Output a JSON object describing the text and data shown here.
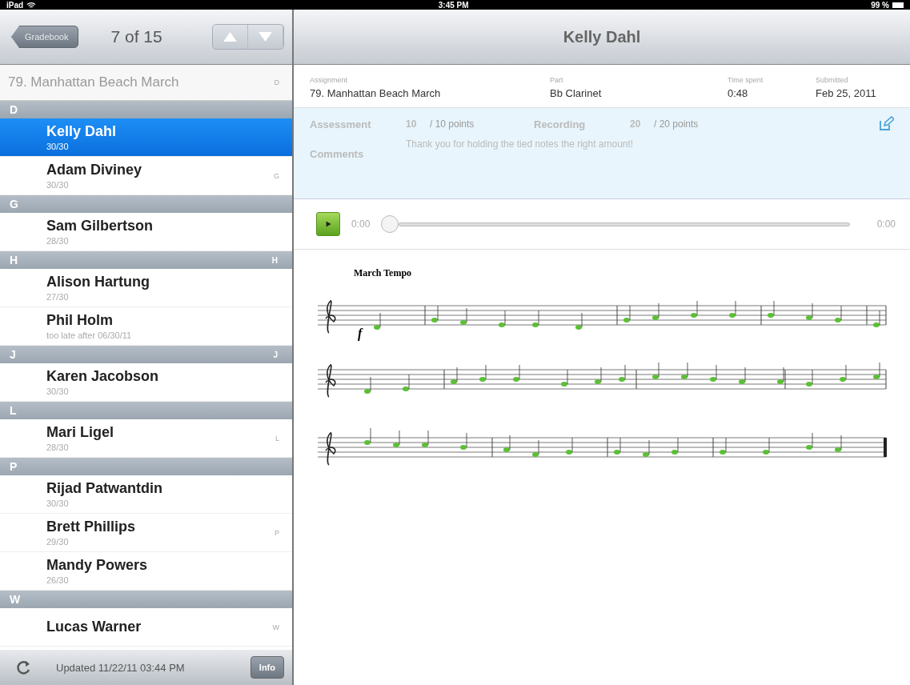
{
  "status_bar": {
    "device": "iPad",
    "time": "3:45 PM",
    "battery": "99 %"
  },
  "nav": {
    "back": "Gradebook",
    "counter": "7 of 15"
  },
  "assignment_title": {
    "text": "79. Manhattan Beach March",
    "index": "D"
  },
  "sections": [
    {
      "letter": "D",
      "students": [
        {
          "name": "Kelly Dahl",
          "score": "30/30",
          "selected": true
        },
        {
          "name": "Adam Diviney",
          "score": "30/30",
          "selected": false,
          "index": "G"
        }
      ]
    },
    {
      "letter": "G",
      "students": [
        {
          "name": "Sam Gilbertson",
          "score": "28/30",
          "selected": false
        }
      ]
    },
    {
      "letter": "H",
      "index": "H",
      "students": [
        {
          "name": "Alison Hartung",
          "score": "27/30",
          "selected": false
        },
        {
          "name": "Phil Holm",
          "score": "too late after 06/30/11",
          "selected": false
        }
      ]
    },
    {
      "letter": "J",
      "index": "J",
      "students": [
        {
          "name": "Karen Jacobson",
          "score": "30/30",
          "selected": false
        }
      ]
    },
    {
      "letter": "L",
      "students": [
        {
          "name": "Mari Ligel",
          "score": "28/30",
          "selected": false,
          "index": "L"
        }
      ]
    },
    {
      "letter": "P",
      "students": [
        {
          "name": "Rijad Patwantdin",
          "score": "30/30",
          "selected": false
        },
        {
          "name": "Brett Phillips",
          "score": "29/30",
          "selected": false,
          "index": "P"
        },
        {
          "name": "Mandy Powers",
          "score": "26/30",
          "selected": false
        }
      ]
    },
    {
      "letter": "W",
      "students": [
        {
          "name": "Lucas Warner",
          "selected": false,
          "index": "W"
        }
      ]
    }
  ],
  "footer": {
    "updated": "Updated 11/22/11 03:44 PM",
    "info": "Info"
  },
  "detail": {
    "title": "Kelly Dahl",
    "fields": [
      {
        "label": "Assignment",
        "value": "79. Manhattan Beach March"
      },
      {
        "label": "Part",
        "value": "Bb Clarinet"
      },
      {
        "label": "Time spent",
        "value": "0:48"
      },
      {
        "label": "Submitted",
        "value": "Feb 25, 2011"
      }
    ],
    "grades": [
      {
        "label": "Assessment",
        "score": "10",
        "total": "/ 10 points"
      },
      {
        "label": "Recording",
        "score": "20",
        "total": "/ 20 points"
      }
    ],
    "comments_label": "Comments",
    "comment": "Thank you for holding the tied notes the right amount!",
    "player": {
      "elapsed": "0:00",
      "duration": "0:00",
      "level": 0
    },
    "music": {
      "tempo": "March Tempo",
      "dynamic": "f"
    }
  }
}
